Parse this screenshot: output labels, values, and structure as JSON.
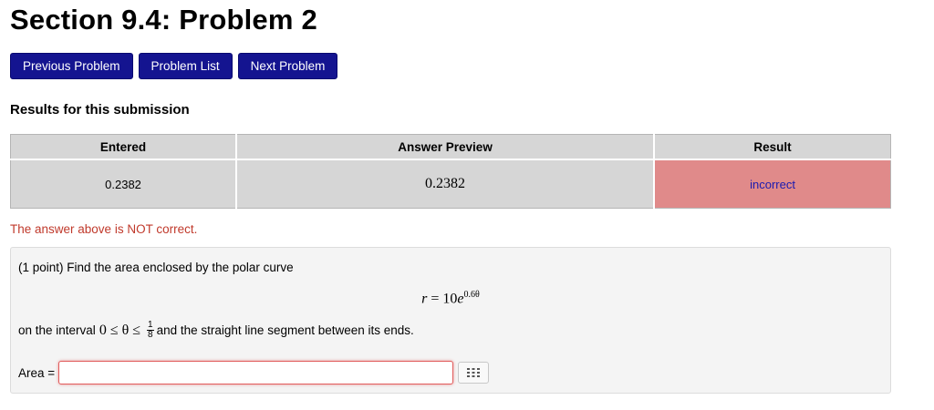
{
  "page_title": "Section 9.4: Problem 2",
  "nav": {
    "previous_label": "Previous Problem",
    "list_label": "Problem List",
    "next_label": "Next Problem"
  },
  "results": {
    "heading": "Results for this submission",
    "columns": [
      "Entered",
      "Answer Preview",
      "Result"
    ],
    "row": {
      "entered": "0.2382",
      "preview": "0.2382",
      "result": "incorrect"
    }
  },
  "feedback_message": "The answer above is NOT correct.",
  "problem": {
    "prompt": "(1 point) Find the area enclosed by the polar curve",
    "equation_lhs": "r",
    "equation_eq": "= 10",
    "equation_base": "e",
    "equation_exponent": "0.6θ",
    "interval_prefix": "on the interval",
    "interval_math": "0 ≤ θ ≤",
    "interval_num": "1",
    "interval_den": "8",
    "interval_suffix": "and the straight line segment between its ends.",
    "answer_label": "Area =",
    "answer_value": ""
  },
  "colors": {
    "nav_button": "#141490",
    "incorrect_cell": "#e08a8a",
    "error_text": "#c0392b"
  },
  "icons": {
    "keypad": "grid-keypad-icon"
  }
}
